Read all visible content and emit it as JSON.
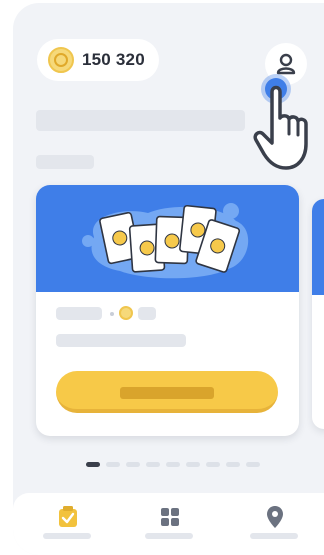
{
  "header": {
    "coins": "150 320",
    "coin_icon": "coin-icon",
    "profile_icon": "profile-icon"
  },
  "tutorial": {
    "pointer_icon": "tap-hand-icon",
    "tap_highlight_color": "#3f7ee8"
  },
  "card": {
    "illustration_icon": "emoji-cards-icon",
    "banner_color": "#3f7ee8",
    "button_color": "#f7c948"
  },
  "pagination": {
    "total": 9,
    "active_index": 0
  },
  "tabbar": {
    "items": [
      {
        "icon": "checklist-icon",
        "active_color": "#f2c23d"
      },
      {
        "icon": "grid-icon"
      },
      {
        "icon": "location-pin-icon"
      }
    ]
  },
  "colors": {
    "background": "#f1f3f7",
    "skeleton": "#e3e6ec",
    "text_dark": "#2b2f3a"
  }
}
